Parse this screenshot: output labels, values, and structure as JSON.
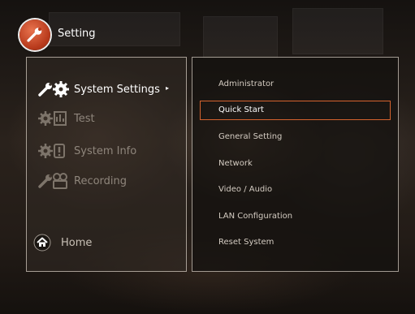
{
  "header": {
    "title": "Setting",
    "icon": "wrench-icon"
  },
  "left_menu": {
    "items": [
      {
        "label": "System Settings",
        "icon": "wrench-gear-icon",
        "active": true
      },
      {
        "label": "Test",
        "icon": "gear-test-icon",
        "active": false
      },
      {
        "label": "System Info",
        "icon": "gear-info-icon",
        "active": false
      },
      {
        "label": "Recording",
        "icon": "wrench-recording-icon",
        "active": false
      },
      {
        "label": "Home",
        "icon": "home-icon",
        "active": true
      }
    ],
    "arrow": "▸"
  },
  "sub_menu": {
    "items": [
      {
        "label": "Administrator",
        "selected": false
      },
      {
        "label": "Quick Start",
        "selected": true
      },
      {
        "label": "General Setting",
        "selected": false
      },
      {
        "label": "Network",
        "selected": false
      },
      {
        "label": "Video / Audio",
        "selected": false
      },
      {
        "label": "LAN Configuration",
        "selected": false
      },
      {
        "label": "Reset System",
        "selected": false
      }
    ]
  },
  "colors": {
    "accent": "#d4622e",
    "title_icon": "#c2421e",
    "active_text": "#ffffff",
    "dim_text": "#8f867c"
  }
}
